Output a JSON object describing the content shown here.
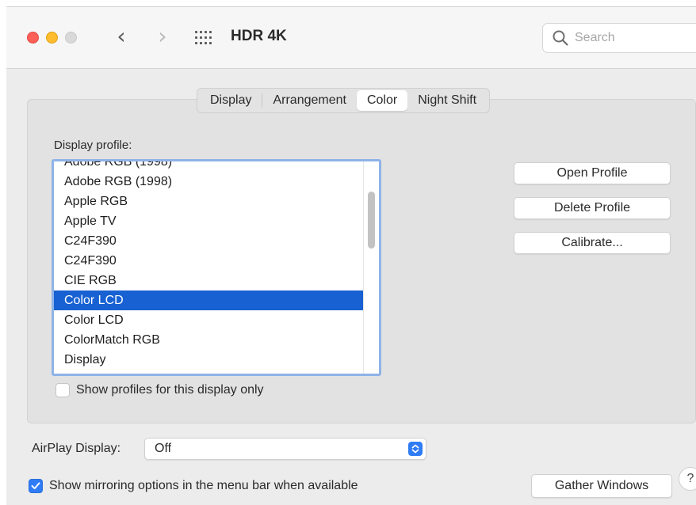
{
  "window": {
    "title": "HDR 4K",
    "back_glyph": "‹",
    "forward_glyph": "›"
  },
  "search": {
    "placeholder": "Search"
  },
  "tabs": [
    {
      "label": "Display",
      "selected": false
    },
    {
      "label": "Arrangement",
      "selected": false
    },
    {
      "label": "Color",
      "selected": true
    },
    {
      "label": "Night Shift",
      "selected": false
    }
  ],
  "color_pane": {
    "profile_label": "Display profile:",
    "profiles": [
      "Adobe RGB (1998)",
      "Adobe RGB (1998)",
      "Apple RGB",
      "Apple TV",
      "C24F390",
      "C24F390",
      "CIE RGB",
      "Color LCD",
      "Color LCD",
      "ColorMatch RGB",
      "Display"
    ],
    "selected_profile_index": 7,
    "buttons": {
      "open": "Open Profile",
      "delete": "Delete Profile",
      "calibrate": "Calibrate..."
    },
    "show_profiles_only": {
      "label": "Show profiles for this display only",
      "checked": false
    }
  },
  "airplay": {
    "label": "AirPlay Display:",
    "value": "Off"
  },
  "mirroring": {
    "label": "Show mirroring options in the menu bar when available",
    "checked": true
  },
  "gather_button": "Gather Windows",
  "help_glyph": "?",
  "colors": {
    "accent": "#2f7cf6",
    "selection": "#1761d2",
    "close": "#fe5f57",
    "minimize": "#febc2e"
  }
}
